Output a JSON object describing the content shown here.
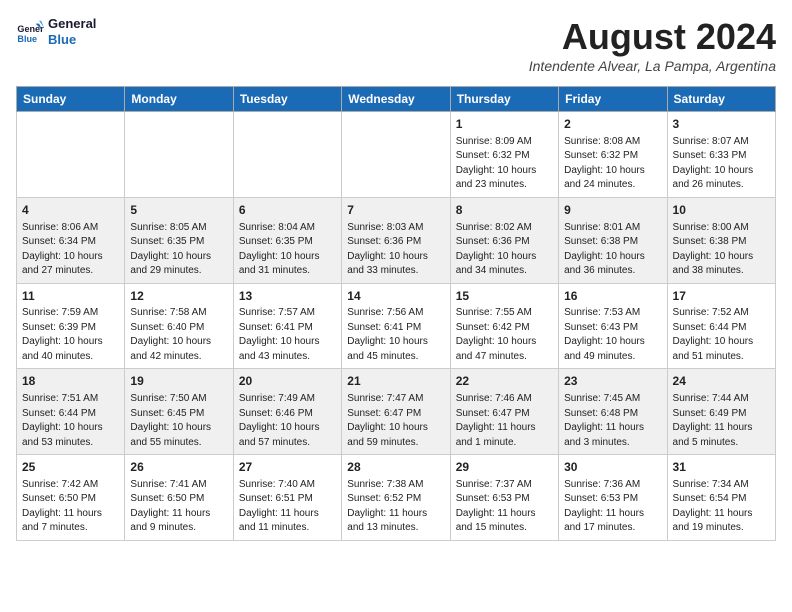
{
  "header": {
    "logo_line1": "General",
    "logo_line2": "Blue",
    "month_title": "August 2024",
    "subtitle": "Intendente Alvear, La Pampa, Argentina"
  },
  "weekdays": [
    "Sunday",
    "Monday",
    "Tuesday",
    "Wednesday",
    "Thursday",
    "Friday",
    "Saturday"
  ],
  "weeks": [
    [
      null,
      null,
      null,
      null,
      {
        "day": 1,
        "sunrise": "8:09 AM",
        "sunset": "6:32 PM",
        "daylight": "10 hours and 23 minutes."
      },
      {
        "day": 2,
        "sunrise": "8:08 AM",
        "sunset": "6:32 PM",
        "daylight": "10 hours and 24 minutes."
      },
      {
        "day": 3,
        "sunrise": "8:07 AM",
        "sunset": "6:33 PM",
        "daylight": "10 hours and 26 minutes."
      }
    ],
    [
      {
        "day": 4,
        "sunrise": "8:06 AM",
        "sunset": "6:34 PM",
        "daylight": "10 hours and 27 minutes."
      },
      {
        "day": 5,
        "sunrise": "8:05 AM",
        "sunset": "6:35 PM",
        "daylight": "10 hours and 29 minutes."
      },
      {
        "day": 6,
        "sunrise": "8:04 AM",
        "sunset": "6:35 PM",
        "daylight": "10 hours and 31 minutes."
      },
      {
        "day": 7,
        "sunrise": "8:03 AM",
        "sunset": "6:36 PM",
        "daylight": "10 hours and 33 minutes."
      },
      {
        "day": 8,
        "sunrise": "8:02 AM",
        "sunset": "6:36 PM",
        "daylight": "10 hours and 34 minutes."
      },
      {
        "day": 9,
        "sunrise": "8:01 AM",
        "sunset": "6:38 PM",
        "daylight": "10 hours and 36 minutes."
      },
      {
        "day": 10,
        "sunrise": "8:00 AM",
        "sunset": "6:38 PM",
        "daylight": "10 hours and 38 minutes."
      }
    ],
    [
      {
        "day": 11,
        "sunrise": "7:59 AM",
        "sunset": "6:39 PM",
        "daylight": "10 hours and 40 minutes."
      },
      {
        "day": 12,
        "sunrise": "7:58 AM",
        "sunset": "6:40 PM",
        "daylight": "10 hours and 42 minutes."
      },
      {
        "day": 13,
        "sunrise": "7:57 AM",
        "sunset": "6:41 PM",
        "daylight": "10 hours and 43 minutes."
      },
      {
        "day": 14,
        "sunrise": "7:56 AM",
        "sunset": "6:41 PM",
        "daylight": "10 hours and 45 minutes."
      },
      {
        "day": 15,
        "sunrise": "7:55 AM",
        "sunset": "6:42 PM",
        "daylight": "10 hours and 47 minutes."
      },
      {
        "day": 16,
        "sunrise": "7:53 AM",
        "sunset": "6:43 PM",
        "daylight": "10 hours and 49 minutes."
      },
      {
        "day": 17,
        "sunrise": "7:52 AM",
        "sunset": "6:44 PM",
        "daylight": "10 hours and 51 minutes."
      }
    ],
    [
      {
        "day": 18,
        "sunrise": "7:51 AM",
        "sunset": "6:44 PM",
        "daylight": "10 hours and 53 minutes."
      },
      {
        "day": 19,
        "sunrise": "7:50 AM",
        "sunset": "6:45 PM",
        "daylight": "10 hours and 55 minutes."
      },
      {
        "day": 20,
        "sunrise": "7:49 AM",
        "sunset": "6:46 PM",
        "daylight": "10 hours and 57 minutes."
      },
      {
        "day": 21,
        "sunrise": "7:47 AM",
        "sunset": "6:47 PM",
        "daylight": "10 hours and 59 minutes."
      },
      {
        "day": 22,
        "sunrise": "7:46 AM",
        "sunset": "6:47 PM",
        "daylight": "11 hours and 1 minute."
      },
      {
        "day": 23,
        "sunrise": "7:45 AM",
        "sunset": "6:48 PM",
        "daylight": "11 hours and 3 minutes."
      },
      {
        "day": 24,
        "sunrise": "7:44 AM",
        "sunset": "6:49 PM",
        "daylight": "11 hours and 5 minutes."
      }
    ],
    [
      {
        "day": 25,
        "sunrise": "7:42 AM",
        "sunset": "6:50 PM",
        "daylight": "11 hours and 7 minutes."
      },
      {
        "day": 26,
        "sunrise": "7:41 AM",
        "sunset": "6:50 PM",
        "daylight": "11 hours and 9 minutes."
      },
      {
        "day": 27,
        "sunrise": "7:40 AM",
        "sunset": "6:51 PM",
        "daylight": "11 hours and 11 minutes."
      },
      {
        "day": 28,
        "sunrise": "7:38 AM",
        "sunset": "6:52 PM",
        "daylight": "11 hours and 13 minutes."
      },
      {
        "day": 29,
        "sunrise": "7:37 AM",
        "sunset": "6:53 PM",
        "daylight": "11 hours and 15 minutes."
      },
      {
        "day": 30,
        "sunrise": "7:36 AM",
        "sunset": "6:53 PM",
        "daylight": "11 hours and 17 minutes."
      },
      {
        "day": 31,
        "sunrise": "7:34 AM",
        "sunset": "6:54 PM",
        "daylight": "11 hours and 19 minutes."
      }
    ]
  ]
}
